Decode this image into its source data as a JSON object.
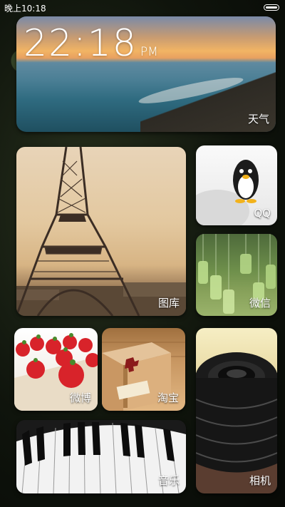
{
  "status_bar": {
    "time": "晚上10:18",
    "battery_icon": "battery-icon"
  },
  "weather_tile": {
    "time": "22:18",
    "ampm": "PM",
    "label": "天气"
  },
  "tiles": {
    "gallery": "图库",
    "qq": "QQ",
    "wechat": "微信",
    "weibo": "微博",
    "taobao": "淘宝",
    "music": "音乐",
    "camera": "相机"
  }
}
